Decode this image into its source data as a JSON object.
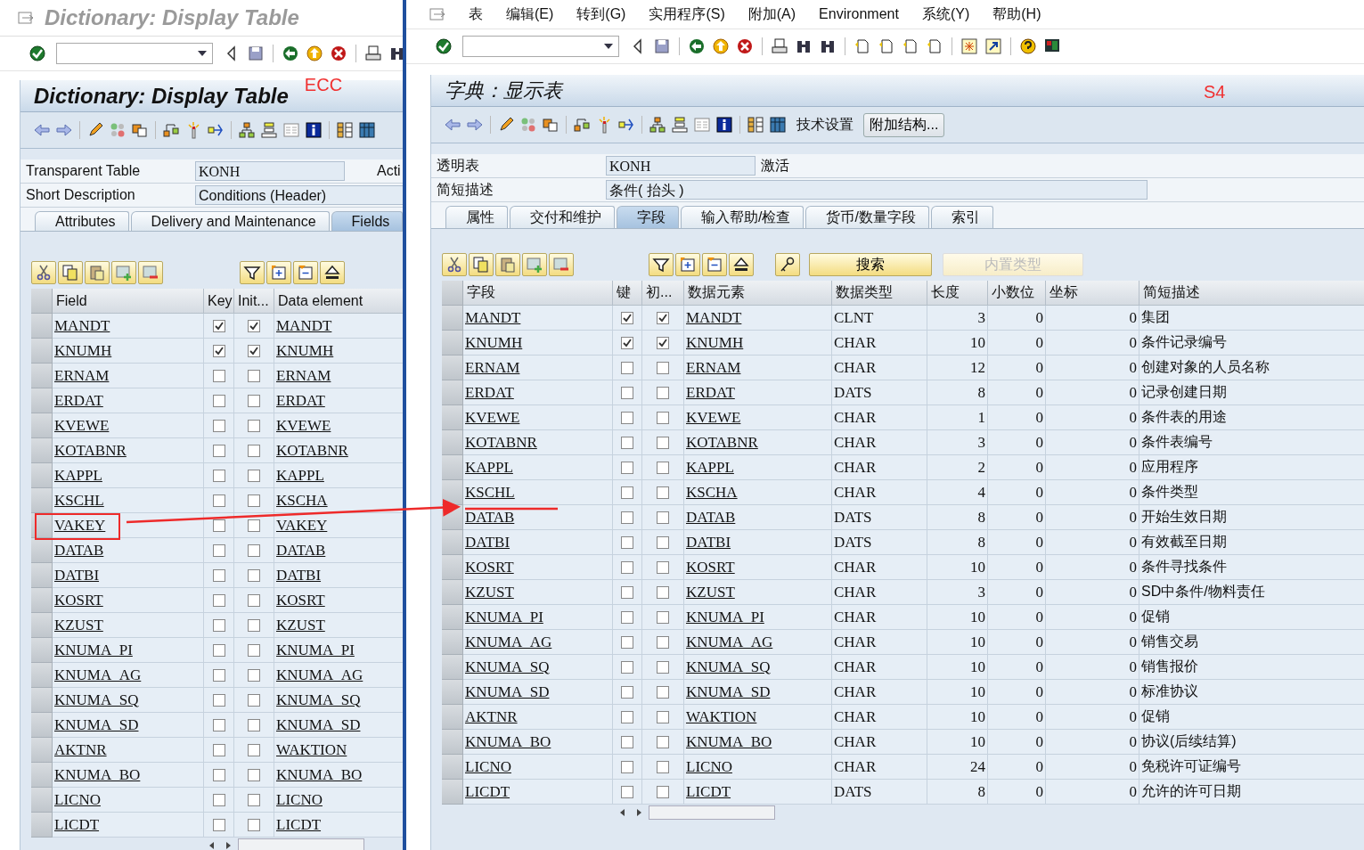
{
  "windows": [
    {
      "title": "Dictionary: Display Table",
      "screen_title": "Dictionary: Display Table",
      "annotation": "ECC",
      "fields": [
        {
          "label": "Transparent Table",
          "value": "KONH",
          "status": "Acti"
        },
        {
          "label": "Short Description",
          "value": "Conditions (Header)"
        }
      ],
      "tabs": [
        {
          "label": "Attributes",
          "selected": false
        },
        {
          "label": "Delivery and Maintenance",
          "selected": false
        },
        {
          "label": "Fields",
          "selected": true
        }
      ],
      "table": {
        "columns": [
          {
            "label": "Field",
            "kind": "link"
          },
          {
            "label": "Key",
            "kind": "check"
          },
          {
            "label": "Init...",
            "kind": "check"
          },
          {
            "label": "Data element",
            "kind": "link"
          }
        ],
        "rows": [
          {
            "cells": [
              "MANDT",
              {
                "checked": true
              },
              {
                "checked": true
              },
              "MANDT"
            ]
          },
          {
            "cells": [
              "KNUMH",
              {
                "checked": true
              },
              {
                "checked": true
              },
              "KNUMH"
            ]
          },
          {
            "cells": [
              "ERNAM",
              {
                "checked": false
              },
              {
                "checked": false
              },
              "ERNAM"
            ]
          },
          {
            "cells": [
              "ERDAT",
              {
                "checked": false
              },
              {
                "checked": false
              },
              "ERDAT"
            ]
          },
          {
            "cells": [
              "KVEWE",
              {
                "checked": false
              },
              {
                "checked": false
              },
              "KVEWE"
            ]
          },
          {
            "cells": [
              "KOTABNR",
              {
                "checked": false
              },
              {
                "checked": false
              },
              "KOTABNR"
            ]
          },
          {
            "cells": [
              "KAPPL",
              {
                "checked": false
              },
              {
                "checked": false
              },
              "KAPPL"
            ]
          },
          {
            "cells": [
              "KSCHL",
              {
                "checked": false
              },
              {
                "checked": false
              },
              "KSCHA"
            ]
          },
          {
            "cells": [
              "VAKEY",
              {
                "checked": false
              },
              {
                "checked": false
              },
              "VAKEY"
            ]
          },
          {
            "cells": [
              "DATAB",
              {
                "checked": false
              },
              {
                "checked": false
              },
              "DATAB"
            ]
          },
          {
            "cells": [
              "DATBI",
              {
                "checked": false
              },
              {
                "checked": false
              },
              "DATBI"
            ]
          },
          {
            "cells": [
              "KOSRT",
              {
                "checked": false
              },
              {
                "checked": false
              },
              "KOSRT"
            ]
          },
          {
            "cells": [
              "KZUST",
              {
                "checked": false
              },
              {
                "checked": false
              },
              "KZUST"
            ]
          },
          {
            "cells": [
              "KNUMA_PI",
              {
                "checked": false
              },
              {
                "checked": false
              },
              "KNUMA_PI"
            ]
          },
          {
            "cells": [
              "KNUMA_AG",
              {
                "checked": false
              },
              {
                "checked": false
              },
              "KNUMA_AG"
            ]
          },
          {
            "cells": [
              "KNUMA_SQ",
              {
                "checked": false
              },
              {
                "checked": false
              },
              "KNUMA_SQ"
            ]
          },
          {
            "cells": [
              "KNUMA_SD",
              {
                "checked": false
              },
              {
                "checked": false
              },
              "KNUMA_SD"
            ]
          },
          {
            "cells": [
              "AKTNR",
              {
                "checked": false
              },
              {
                "checked": false
              },
              "WAKTION"
            ]
          },
          {
            "cells": [
              "KNUMA_BO",
              {
                "checked": false
              },
              {
                "checked": false
              },
              "KNUMA_BO"
            ]
          },
          {
            "cells": [
              "LICNO",
              {
                "checked": false
              },
              {
                "checked": false
              },
              "LICNO"
            ]
          },
          {
            "cells": [
              "LICDT",
              {
                "checked": false
              },
              {
                "checked": false
              },
              "LICDT"
            ]
          }
        ]
      }
    },
    {
      "menu": [
        "表",
        "编辑(E)",
        "转到(G)",
        "实用程序(S)",
        "附加(A)",
        "Environment",
        "系统(Y)",
        "帮助(H)"
      ],
      "screen_title": "字典：显示表",
      "annotation": "S4",
      "app_buttons": [
        {
          "label": "技术设置",
          "kind": "text"
        },
        {
          "label": "附加结构...",
          "kind": "button"
        }
      ],
      "fields": [
        {
          "label": "透明表",
          "value": "KONH",
          "status": "激活"
        },
        {
          "label": "简短描述",
          "value": "条件( 抬头 )"
        }
      ],
      "tabs": [
        {
          "label": "属性",
          "selected": false
        },
        {
          "label": "交付和维护",
          "selected": false
        },
        {
          "label": "字段",
          "selected": true
        },
        {
          "label": "输入帮助/检查",
          "selected": false
        },
        {
          "label": "货币/数量字段",
          "selected": false
        },
        {
          "label": "索引",
          "selected": false
        }
      ],
      "table_buttons": [
        {
          "label": "搜索",
          "disabled": false
        },
        {
          "label": "内置类型",
          "disabled": true
        }
      ],
      "table": {
        "columns": [
          {
            "label": "字段",
            "kind": "link"
          },
          {
            "label": "键",
            "kind": "check"
          },
          {
            "label": "初...",
            "kind": "check"
          },
          {
            "label": "数据元素",
            "kind": "link"
          },
          {
            "label": "数据类型",
            "kind": "text"
          },
          {
            "label": "长度",
            "kind": "num"
          },
          {
            "label": "小数位",
            "kind": "num"
          },
          {
            "label": "坐标",
            "kind": "num"
          },
          {
            "label": "简短描述",
            "kind": "text"
          }
        ],
        "rows": [
          {
            "cells": [
              "MANDT",
              {
                "checked": true
              },
              {
                "checked": true
              },
              "MANDT",
              "CLNT",
              "3",
              "0",
              "0",
              "集团"
            ]
          },
          {
            "cells": [
              "KNUMH",
              {
                "checked": true
              },
              {
                "checked": true
              },
              "KNUMH",
              "CHAR",
              "10",
              "0",
              "0",
              "条件记录编号"
            ]
          },
          {
            "cells": [
              "ERNAM",
              {
                "checked": false
              },
              {
                "checked": false
              },
              "ERNAM",
              "CHAR",
              "12",
              "0",
              "0",
              "创建对象的人员名称"
            ]
          },
          {
            "cells": [
              "ERDAT",
              {
                "checked": false
              },
              {
                "checked": false
              },
              "ERDAT",
              "DATS",
              "8",
              "0",
              "0",
              "记录创建日期"
            ]
          },
          {
            "cells": [
              "KVEWE",
              {
                "checked": false
              },
              {
                "checked": false
              },
              "KVEWE",
              "CHAR",
              "1",
              "0",
              "0",
              "条件表的用途"
            ]
          },
          {
            "cells": [
              "KOTABNR",
              {
                "checked": false
              },
              {
                "checked": false
              },
              "KOTABNR",
              "CHAR",
              "3",
              "0",
              "0",
              "条件表编号"
            ]
          },
          {
            "cells": [
              "KAPPL",
              {
                "checked": false
              },
              {
                "checked": false
              },
              "KAPPL",
              "CHAR",
              "2",
              "0",
              "0",
              "应用程序"
            ]
          },
          {
            "cells": [
              "KSCHL",
              {
                "checked": false
              },
              {
                "checked": false
              },
              "KSCHA",
              "CHAR",
              "4",
              "0",
              "0",
              "条件类型"
            ]
          },
          {
            "cells": [
              "DATAB",
              {
                "checked": false
              },
              {
                "checked": false
              },
              "DATAB",
              "DATS",
              "8",
              "0",
              "0",
              "开始生效日期"
            ]
          },
          {
            "cells": [
              "DATBI",
              {
                "checked": false
              },
              {
                "checked": false
              },
              "DATBI",
              "DATS",
              "8",
              "0",
              "0",
              "有效截至日期"
            ]
          },
          {
            "cells": [
              "KOSRT",
              {
                "checked": false
              },
              {
                "checked": false
              },
              "KOSRT",
              "CHAR",
              "10",
              "0",
              "0",
              "条件寻找条件"
            ]
          },
          {
            "cells": [
              "KZUST",
              {
                "checked": false
              },
              {
                "checked": false
              },
              "KZUST",
              "CHAR",
              "3",
              "0",
              "0",
              "SD中条件/物料责任"
            ]
          },
          {
            "cells": [
              "KNUMA_PI",
              {
                "checked": false
              },
              {
                "checked": false
              },
              "KNUMA_PI",
              "CHAR",
              "10",
              "0",
              "0",
              "促销"
            ]
          },
          {
            "cells": [
              "KNUMA_AG",
              {
                "checked": false
              },
              {
                "checked": false
              },
              "KNUMA_AG",
              "CHAR",
              "10",
              "0",
              "0",
              "销售交易"
            ]
          },
          {
            "cells": [
              "KNUMA_SQ",
              {
                "checked": false
              },
              {
                "checked": false
              },
              "KNUMA_SQ",
              "CHAR",
              "10",
              "0",
              "0",
              "销售报价"
            ]
          },
          {
            "cells": [
              "KNUMA_SD",
              {
                "checked": false
              },
              {
                "checked": false
              },
              "KNUMA_SD",
              "CHAR",
              "10",
              "0",
              "0",
              "标准协议"
            ]
          },
          {
            "cells": [
              "AKTNR",
              {
                "checked": false
              },
              {
                "checked": false
              },
              "WAKTION",
              "CHAR",
              "10",
              "0",
              "0",
              "促销"
            ]
          },
          {
            "cells": [
              "KNUMA_BO",
              {
                "checked": false
              },
              {
                "checked": false
              },
              "KNUMA_BO",
              "CHAR",
              "10",
              "0",
              "0",
              "协议(后续结算)"
            ]
          },
          {
            "cells": [
              "LICNO",
              {
                "checked": false
              },
              {
                "checked": false
              },
              "LICNO",
              "CHAR",
              "24",
              "0",
              "0",
              "免税许可证编号"
            ]
          },
          {
            "cells": [
              "LICDT",
              {
                "checked": false
              },
              {
                "checked": false
              },
              "LICDT",
              "DATS",
              "8",
              "0",
              "0",
              "允许的许可日期"
            ]
          }
        ]
      }
    }
  ]
}
